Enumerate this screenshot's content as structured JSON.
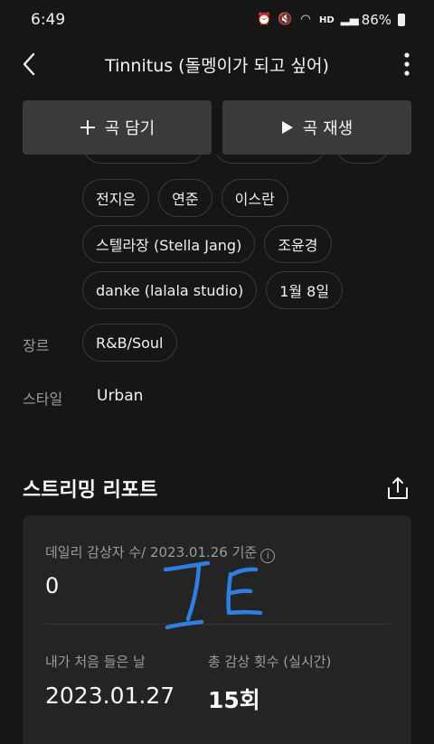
{
  "status": {
    "time": "6:49",
    "battery": "86%",
    "hd_label": "HD"
  },
  "nav": {
    "title": "Tinnitus (돌멩이가 되고 싶어)"
  },
  "actions": {
    "add_label": "곡 담기",
    "play_label": "곡 재생"
  },
  "credits": {
    "row1": [
      "전지은",
      "연준",
      "이스란"
    ],
    "row2": [
      "스텔라장 (Stella Jang)",
      "조윤경"
    ],
    "row3": [
      "danke (lalala studio)",
      "1월 8일"
    ]
  },
  "meta": {
    "genre_label": "장르",
    "genre_value": "R&B/Soul",
    "style_label": "스타일",
    "style_value": "Urban"
  },
  "report": {
    "title": "스트리밍 리포트",
    "daily_label": "데일리 감상자 수/ 2023.01.26 기준",
    "daily_value": "0",
    "first_label": "내가 처음 들은 날",
    "first_value": "2023.01.27",
    "total_label": "총 감상 횟수 (실시간)",
    "total_value": "15회"
  },
  "colors": {
    "background": "#161616",
    "button": "#3a3a3a",
    "card": "#242424",
    "scribble": "#2f7fe0"
  }
}
